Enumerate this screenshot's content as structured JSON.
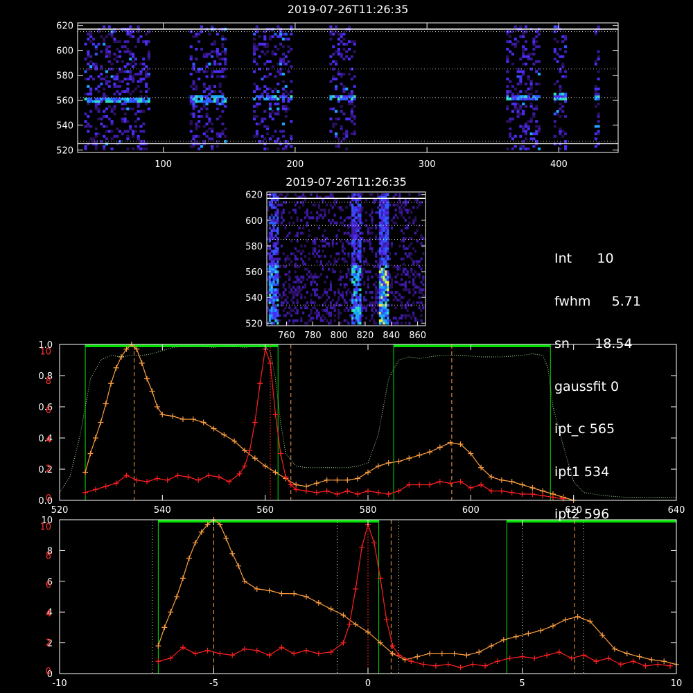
{
  "colors": {
    "background": "#000000",
    "axis": "#ffffff",
    "orange": "#ffa040",
    "red": "#ff2020",
    "green": "#00e000",
    "dotted": "#b0b0b0",
    "axis_red": "#ff3030"
  },
  "info": {
    "int_label": "Int",
    "int_value": "10",
    "fwhm_label": "fwhm",
    "fwhm_value": "5.71",
    "sn_label": "sn",
    "sn_value": "18.54",
    "gaussfit": "gaussfit 0",
    "ipt_c": "ipt_c 565",
    "ipt1": "ipt1 534",
    "ipt2": "ipt2 596"
  },
  "chart_data": [
    {
      "type": "heatmap",
      "title": "2019-07-26T11:26:35",
      "xlim": [
        35,
        445
      ],
      "ylim": [
        518,
        622
      ],
      "xticks": [
        100,
        200,
        300,
        400
      ],
      "yticks": [
        520,
        540,
        560,
        580,
        600,
        620
      ],
      "hlines_solid": [
        525,
        617
      ],
      "hlines_dotted": [
        615,
        585,
        562,
        527
      ],
      "bands": [
        {
          "x0": 40,
          "x1": 90,
          "hot_y": 559
        },
        {
          "x0": 120,
          "x1": 147,
          "hot_y": 560
        },
        {
          "x0": 168,
          "x1": 198,
          "hot_y": 561
        },
        {
          "x0": 226,
          "x1": 246,
          "hot_y": 561
        },
        {
          "x0": 360,
          "x1": 385,
          "hot_y": 561
        },
        {
          "x0": 396,
          "x1": 405,
          "hot_y": 562
        },
        {
          "x0": 427,
          "x1": 431,
          "hot_y": 561
        }
      ]
    },
    {
      "type": "heatmap",
      "title": "2019-07-26T11:26:35",
      "xlim": [
        745,
        866
      ],
      "ylim": [
        518,
        622
      ],
      "xticks": [
        760,
        780,
        800,
        820,
        840,
        860
      ],
      "yticks": [
        520,
        540,
        560,
        580,
        600,
        620
      ],
      "hlines_solid": [
        617
      ],
      "hlines_dotted": [
        614,
        596,
        585,
        565,
        534
      ],
      "hot_columns": [
        {
          "x": 750,
          "strength": 0.5
        },
        {
          "x": 812,
          "strength": 0.7
        },
        {
          "x": 834,
          "strength": 1.0
        }
      ]
    },
    {
      "type": "line",
      "xlim": [
        520,
        640
      ],
      "ylim": [
        0,
        1.0
      ],
      "xticks": [
        520,
        540,
        560,
        580,
        600,
        620,
        640
      ],
      "left_ticks": [
        "0.0",
        "0.2",
        "0.4",
        "0.6",
        "0.8",
        "1.0"
      ],
      "right_ticks": [
        "0",
        "2",
        "4",
        "6",
        "8",
        "10"
      ],
      "filter_bands": [
        [
          525,
          562.5
        ],
        [
          585,
          615.5
        ]
      ],
      "vlines_dashed": [
        534.5,
        565,
        596.3
      ],
      "vline_red": 561,
      "series": [
        {
          "name": "",
          "color": "orange",
          "x": [
            525,
            526,
            527,
            528,
            529,
            530,
            531,
            532,
            533,
            534,
            535,
            536,
            537,
            538,
            539,
            540,
            542,
            544,
            546,
            548,
            550,
            552,
            554,
            556,
            558,
            560,
            562,
            564,
            566,
            568,
            570,
            572,
            574,
            576,
            578,
            580,
            582,
            584,
            586,
            588,
            590,
            592,
            594,
            596,
            598,
            600,
            602,
            604,
            606,
            608,
            610,
            612,
            614,
            616,
            618,
            620
          ],
          "values": [
            0.18,
            0.3,
            0.4,
            0.5,
            0.62,
            0.75,
            0.85,
            0.92,
            0.97,
            1.0,
            0.97,
            0.88,
            0.78,
            0.7,
            0.6,
            0.55,
            0.54,
            0.52,
            0.52,
            0.5,
            0.46,
            0.42,
            0.38,
            0.32,
            0.27,
            0.22,
            0.18,
            0.14,
            0.1,
            0.09,
            0.11,
            0.13,
            0.13,
            0.13,
            0.14,
            0.18,
            0.22,
            0.24,
            0.25,
            0.27,
            0.29,
            0.31,
            0.34,
            0.37,
            0.36,
            0.3,
            0.21,
            0.15,
            0.13,
            0.12,
            0.1,
            0.08,
            0.06,
            0.04,
            0.02,
            0.0
          ]
        },
        {
          "name": "",
          "color": "red",
          "x": [
            525,
            527,
            529,
            531,
            533,
            535,
            537,
            539,
            541,
            543,
            545,
            547,
            549,
            551,
            553,
            555,
            556,
            557,
            558,
            559,
            560,
            561,
            562,
            563,
            564,
            565,
            566,
            568,
            570,
            572,
            574,
            576,
            578,
            580,
            582,
            584,
            586,
            588,
            590,
            592,
            594,
            596,
            598,
            600,
            602,
            604,
            606,
            608,
            610,
            612,
            614,
            616,
            618
          ],
          "values": [
            0.05,
            0.07,
            0.09,
            0.11,
            0.16,
            0.13,
            0.12,
            0.14,
            0.13,
            0.16,
            0.15,
            0.13,
            0.16,
            0.15,
            0.12,
            0.17,
            0.22,
            0.32,
            0.5,
            0.75,
            0.97,
            0.88,
            0.55,
            0.3,
            0.15,
            0.1,
            0.07,
            0.06,
            0.05,
            0.06,
            0.04,
            0.06,
            0.04,
            0.06,
            0.05,
            0.04,
            0.06,
            0.1,
            0.1,
            0.1,
            0.12,
            0.11,
            0.12,
            0.08,
            0.1,
            0.06,
            0.06,
            0.05,
            0.04,
            0.04,
            0.03,
            0.02,
            0.01
          ]
        },
        {
          "name": "",
          "color": "dotted",
          "x": [
            520,
            522,
            524,
            526,
            528,
            530,
            532,
            534,
            536,
            538,
            540,
            542,
            544,
            546,
            548,
            550,
            552,
            554,
            556,
            558,
            560,
            561,
            562,
            563,
            564,
            566,
            568,
            570,
            572,
            574,
            576,
            578,
            580,
            582,
            584,
            586,
            588,
            590,
            594,
            598,
            602,
            606,
            610,
            612,
            614,
            615,
            616,
            618,
            620,
            622,
            626,
            630,
            634,
            638,
            640
          ],
          "values": [
            0.05,
            0.15,
            0.42,
            0.78,
            0.9,
            0.93,
            0.92,
            0.93,
            0.93,
            0.94,
            0.96,
            0.98,
            0.99,
            0.99,
            0.99,
            0.98,
            0.99,
            0.99,
            0.98,
            0.99,
            0.99,
            0.95,
            0.78,
            0.5,
            0.3,
            0.22,
            0.21,
            0.21,
            0.21,
            0.21,
            0.21,
            0.22,
            0.24,
            0.42,
            0.78,
            0.9,
            0.92,
            0.91,
            0.93,
            0.93,
            0.92,
            0.92,
            0.93,
            0.94,
            0.93,
            0.85,
            0.6,
            0.35,
            0.12,
            0.05,
            0.03,
            0.02,
            0.02,
            0.02,
            0.02
          ]
        }
      ]
    },
    {
      "type": "line",
      "xlim": [
        -10,
        10
      ],
      "ylim": [
        0,
        1.0
      ],
      "xticks": [
        -10,
        -5,
        0,
        5,
        10
      ],
      "left_ticks": [
        "0",
        "2",
        "4",
        "6",
        "8",
        "10"
      ],
      "right_ticks": [
        "0",
        "2",
        "4",
        "6",
        "8",
        "10"
      ],
      "filter_bands": [
        [
          -6.8,
          0.35
        ],
        [
          4.5,
          10.0
        ]
      ],
      "vlines_dashed": [
        -5.0,
        0.75,
        6.7
      ],
      "vlines_dotted": [
        -7.0,
        -1.0,
        1.0,
        5.0,
        7.0
      ],
      "vline_red": 0.0,
      "series": [
        {
          "name": "",
          "color": "orange",
          "x": [
            -6.8,
            -6.6,
            -6.4,
            -6.2,
            -6.0,
            -5.8,
            -5.6,
            -5.4,
            -5.2,
            -5.0,
            -4.8,
            -4.6,
            -4.4,
            -4.2,
            -4.0,
            -3.6,
            -3.2,
            -2.8,
            -2.4,
            -2.0,
            -1.6,
            -1.2,
            -0.8,
            -0.4,
            0.0,
            0.4,
            0.8,
            1.2,
            1.6,
            2.0,
            2.4,
            2.8,
            3.2,
            3.6,
            4.0,
            4.4,
            4.8,
            5.2,
            5.6,
            6.0,
            6.4,
            6.8,
            7.2,
            7.6,
            8.0,
            8.4,
            8.8,
            9.2,
            9.6,
            10.0
          ],
          "values": [
            0.18,
            0.3,
            0.4,
            0.5,
            0.62,
            0.75,
            0.85,
            0.92,
            0.97,
            1.0,
            0.97,
            0.88,
            0.78,
            0.7,
            0.6,
            0.55,
            0.54,
            0.52,
            0.52,
            0.5,
            0.46,
            0.42,
            0.38,
            0.32,
            0.27,
            0.2,
            0.13,
            0.09,
            0.11,
            0.13,
            0.13,
            0.13,
            0.12,
            0.14,
            0.18,
            0.22,
            0.24,
            0.26,
            0.28,
            0.31,
            0.35,
            0.37,
            0.34,
            0.25,
            0.16,
            0.13,
            0.11,
            0.09,
            0.08,
            0.06
          ]
        },
        {
          "name": "",
          "color": "red",
          "x": [
            -6.8,
            -6.4,
            -6.0,
            -5.6,
            -5.2,
            -4.8,
            -4.4,
            -4.0,
            -3.6,
            -3.2,
            -2.8,
            -2.4,
            -2.0,
            -1.6,
            -1.2,
            -0.8,
            -0.6,
            -0.4,
            -0.2,
            0.0,
            0.2,
            0.4,
            0.6,
            0.8,
            1.0,
            1.4,
            1.8,
            2.2,
            2.6,
            3.0,
            3.4,
            3.8,
            4.2,
            4.6,
            5.0,
            5.4,
            5.8,
            6.2,
            6.6,
            7.0,
            7.4,
            7.8,
            8.2,
            8.6,
            9.0,
            9.4,
            9.8
          ],
          "values": [
            0.08,
            0.1,
            0.17,
            0.13,
            0.15,
            0.13,
            0.12,
            0.16,
            0.15,
            0.12,
            0.17,
            0.13,
            0.15,
            0.13,
            0.14,
            0.2,
            0.32,
            0.55,
            0.82,
            0.97,
            0.85,
            0.62,
            0.35,
            0.18,
            0.12,
            0.08,
            0.06,
            0.05,
            0.06,
            0.04,
            0.06,
            0.05,
            0.08,
            0.1,
            0.11,
            0.1,
            0.12,
            0.14,
            0.1,
            0.12,
            0.08,
            0.1,
            0.06,
            0.08,
            0.05,
            0.06,
            0.05
          ]
        }
      ]
    }
  ]
}
